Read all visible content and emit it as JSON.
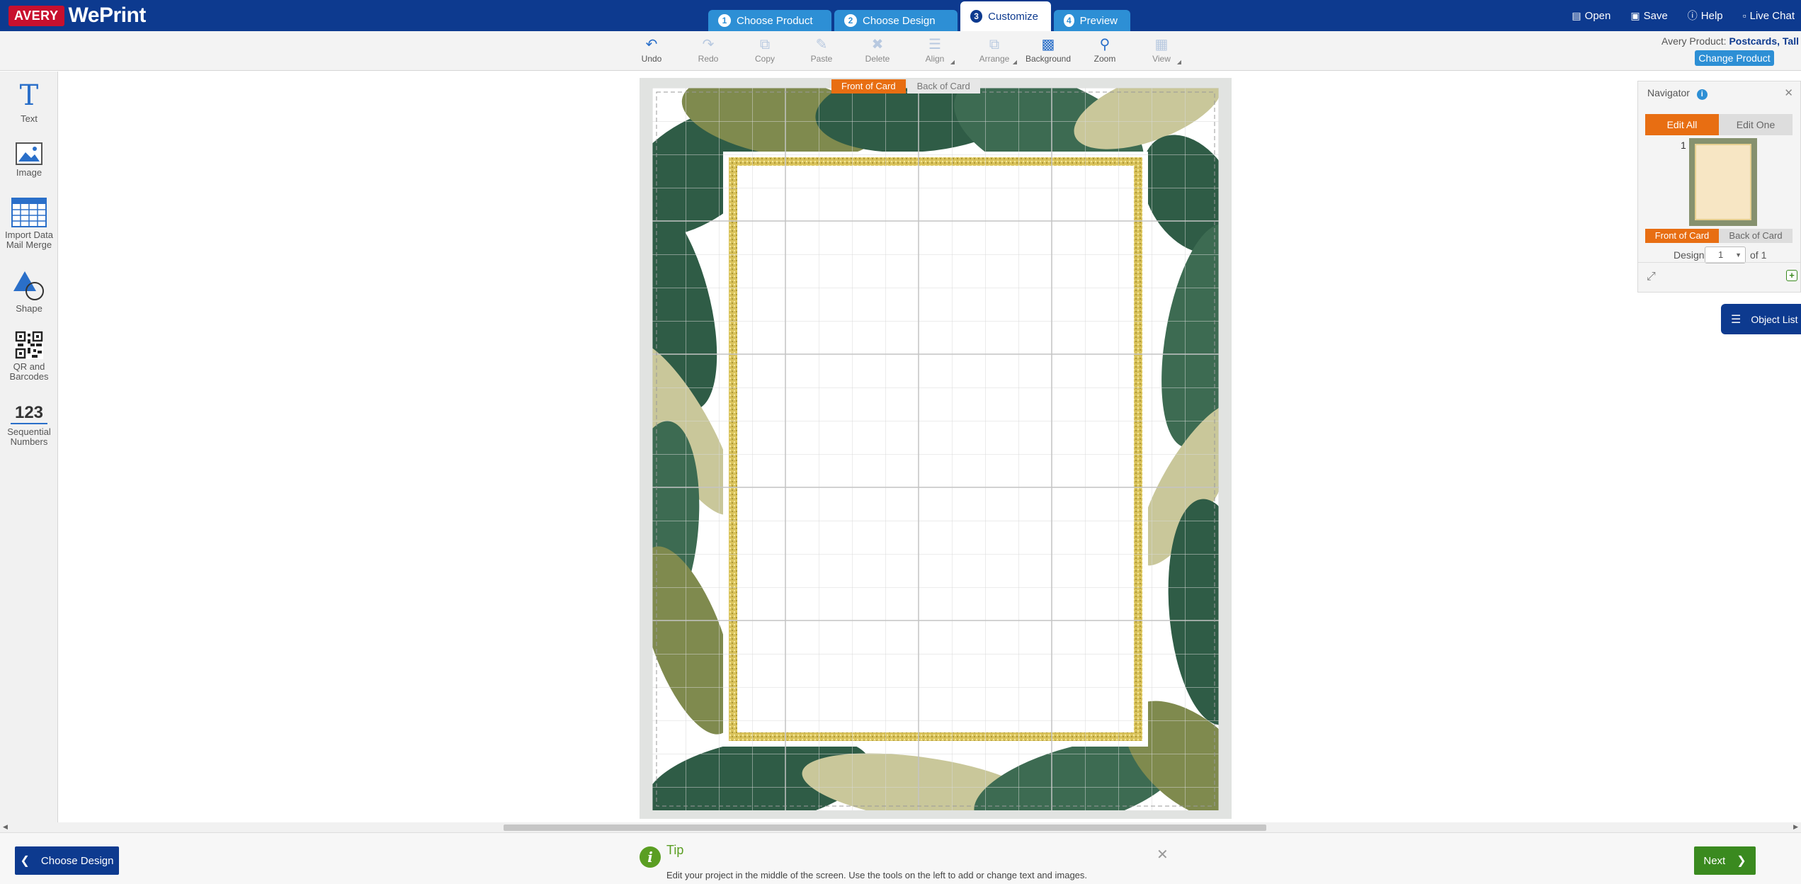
{
  "header": {
    "logo_avery": "AVERY",
    "logo_app": "WePrint",
    "steps": [
      {
        "num": "1",
        "label": "Choose Product"
      },
      {
        "num": "2",
        "label": "Choose Design"
      },
      {
        "num": "3",
        "label": "Customize"
      },
      {
        "num": "4",
        "label": "Preview"
      }
    ],
    "actions": {
      "open": "Open",
      "save": "Save",
      "help": "Help",
      "live_chat": "Live Chat"
    }
  },
  "toolbar": {
    "undo": "Undo",
    "redo": "Redo",
    "copy": "Copy",
    "paste": "Paste",
    "delete": "Delete",
    "align": "Align",
    "arrange": "Arrange",
    "background": "Background",
    "zoom": "Zoom",
    "view": "View"
  },
  "product": {
    "prefix": "Avery Product:",
    "name": "Postcards, Tall",
    "change_label": "Change Product"
  },
  "sidebar": {
    "text": "Text",
    "image": "Image",
    "import_1": "Import Data",
    "import_2": "Mail Merge",
    "shape": "Shape",
    "qr_1": "QR and",
    "qr_2": "Barcodes",
    "seq_glyph": "123",
    "seq_1": "Sequential",
    "seq_2": "Numbers"
  },
  "card_tabs": {
    "front": "Front of Card",
    "back": "Back of Card"
  },
  "navigator": {
    "title": "Navigator",
    "edit_all": "Edit All",
    "edit_one": "Edit One",
    "page_number": "1",
    "front": "Front of Card",
    "back": "Back of Card",
    "design_label": "Design",
    "design_value": "1",
    "design_of": "of 1"
  },
  "object_list": "Object List",
  "tip": {
    "title": "Tip",
    "text": "Edit your project in the middle of the screen. Use the tools on the left to add or change text and images."
  },
  "nav_buttons": {
    "back": "Choose Design",
    "next": "Next"
  },
  "colors": {
    "brand_blue": "#0d3a8f",
    "step_blue": "#2d8fd5",
    "orange": "#e86e12",
    "green": "#3a8a1f"
  }
}
